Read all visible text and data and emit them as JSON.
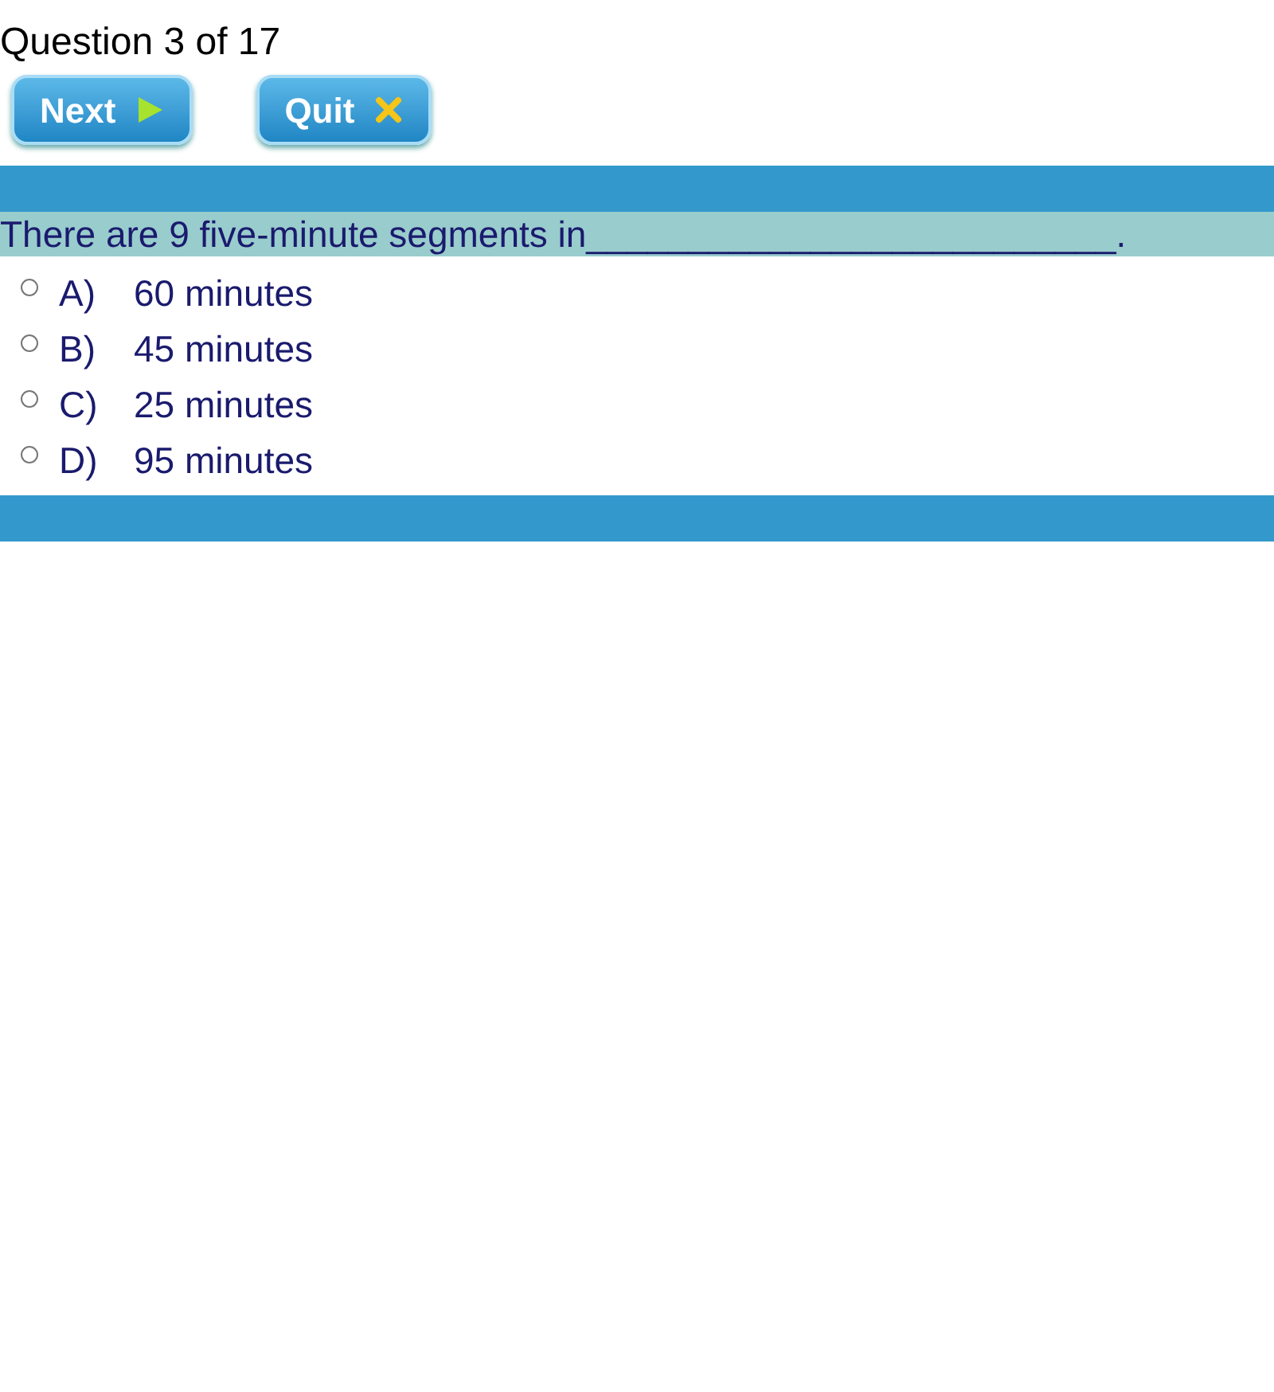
{
  "progress": "Question 3 of 17",
  "buttons": [
    {
      "label": "Next",
      "kind": "next"
    },
    {
      "label": "Quit",
      "kind": "quit"
    }
  ],
  "question": "There are 9 five-minute segments in__________________________.",
  "options": [
    {
      "letter": "A)",
      "text": "60 minutes",
      "selected": false
    },
    {
      "letter": "B)",
      "text": "45 minutes",
      "selected": false
    },
    {
      "letter": "C)",
      "text": "25 minutes",
      "selected": false
    },
    {
      "letter": "D)",
      "text": "95 minutes",
      "selected": false
    }
  ]
}
